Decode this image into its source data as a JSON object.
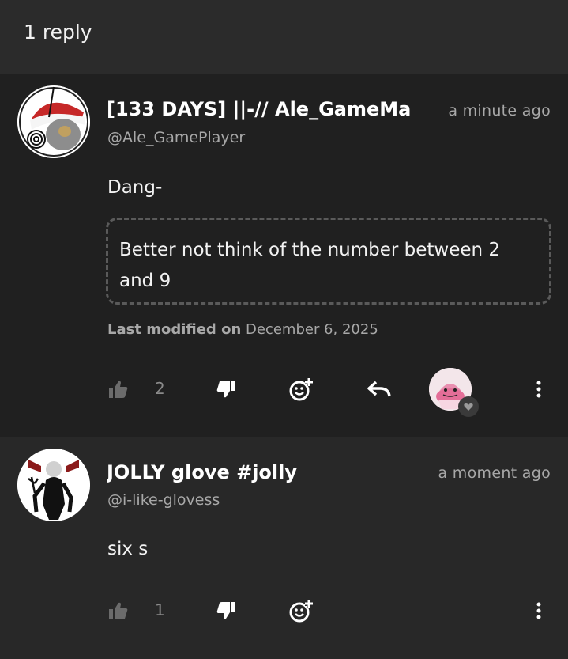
{
  "header": {
    "title": "1 reply"
  },
  "comments": [
    {
      "name": "[133 DAYS] ||-// Ale_GameMa",
      "handle": "@Ale_GamePlayer",
      "time": "a minute ago",
      "text": "Dang-",
      "quote": "Better not think of the number between 2 and 9",
      "modified_label": "Last modified on",
      "modified_date": "December 6, 2025",
      "likes": "2",
      "icons": [
        "thumbs-up-icon",
        "thumbs-down-icon",
        "add-reaction-icon",
        "reply-icon",
        "more-vertical-icon"
      ]
    },
    {
      "name": "JOLLY glove #jolly",
      "handle": "@i-like-glovess",
      "time": "a moment ago",
      "text": "six s",
      "likes": "1",
      "icons": [
        "thumbs-up-icon",
        "thumbs-down-icon",
        "add-reaction-icon",
        "more-vertical-icon"
      ]
    }
  ],
  "colors": {
    "background": "#1f1f1f",
    "header": "#2b2b2b",
    "muted_text": "#a8a8a8",
    "icon": "#ffffff"
  }
}
